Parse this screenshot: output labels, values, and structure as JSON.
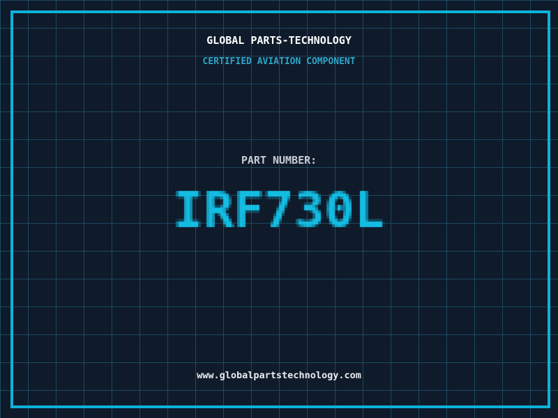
{
  "colors": {
    "background": "#0f1a2a",
    "grid_line": "#1b4a60",
    "frame": "#0db2d8",
    "header_text": "#ffffff",
    "subheader_text": "#2da6c8",
    "label_text": "#c8cdd4",
    "part_number": "#14bce2",
    "footer_text": "#e9ecef"
  },
  "header": {
    "title": "GLOBAL PARTS-TECHNOLOGY",
    "subtitle": "CERTIFIED AVIATION COMPONENT"
  },
  "part_number": {
    "label": "PART NUMBER:",
    "value": "IRF730L"
  },
  "footer": {
    "website": "www.globalpartstechnology.com"
  }
}
